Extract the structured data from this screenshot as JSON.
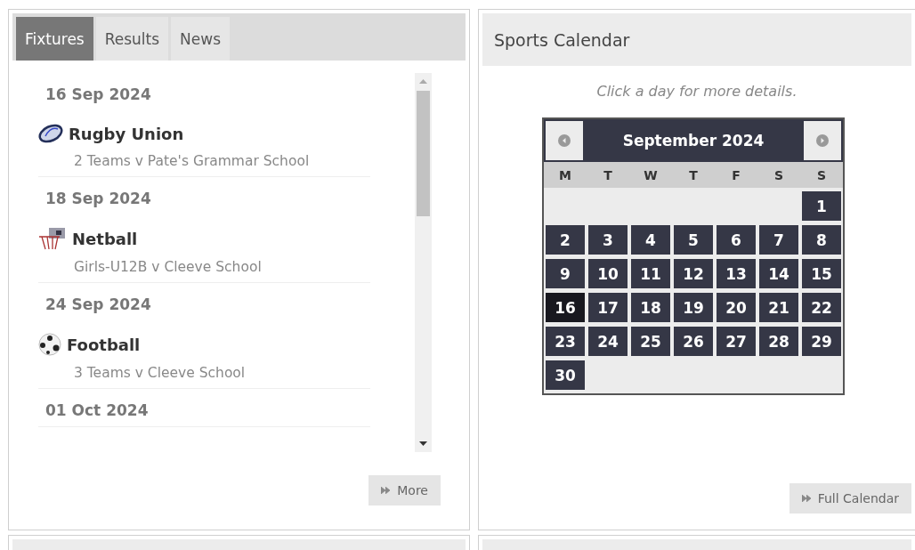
{
  "fixtures_panel": {
    "tabs": [
      {
        "label": "Fixtures",
        "selected": true
      },
      {
        "label": "Results",
        "selected": false
      },
      {
        "label": "News",
        "selected": false
      }
    ],
    "fixtures": [
      {
        "date": "16 Sep 2024",
        "kind": "rugby",
        "sport": "Rugby Union",
        "detail": "2 Teams v Pate's Grammar School"
      },
      {
        "date": "18 Sep 2024",
        "kind": "netball",
        "sport": "Netball",
        "detail": "Girls-U12B v Cleeve School"
      },
      {
        "date": "24 Sep 2024",
        "kind": "football",
        "sport": "Football",
        "detail": "3 Teams v Cleeve School"
      },
      {
        "date": "01 Oct 2024"
      }
    ],
    "more_button": "More"
  },
  "calendar_panel": {
    "title": "Sports Calendar",
    "hint": "Click a day for more details.",
    "month": "September 2024",
    "weekdays": [
      "M",
      "T",
      "W",
      "T",
      "F",
      "S",
      "S"
    ],
    "days": [
      {
        "day": "1",
        "selected": false,
        "kind": "sunday"
      },
      {
        "day": "2",
        "selected": false
      },
      {
        "day": "3",
        "selected": false
      },
      {
        "day": "4",
        "selected": false
      },
      {
        "day": "5",
        "selected": false
      },
      {
        "day": "6",
        "selected": false
      },
      {
        "day": "7",
        "selected": false
      },
      {
        "day": "8",
        "selected": false
      },
      {
        "day": "9",
        "selected": false
      },
      {
        "day": "10",
        "selected": false
      },
      {
        "day": "11",
        "selected": false
      },
      {
        "day": "12",
        "selected": false
      },
      {
        "day": "13",
        "selected": false
      },
      {
        "day": "14",
        "selected": false
      },
      {
        "day": "15",
        "selected": false
      },
      {
        "day": "16",
        "selected": true
      },
      {
        "day": "17",
        "selected": false
      },
      {
        "day": "18",
        "selected": false
      },
      {
        "day": "19",
        "selected": false
      },
      {
        "day": "20",
        "selected": false
      },
      {
        "day": "21",
        "selected": false
      },
      {
        "day": "22",
        "selected": false
      },
      {
        "day": "23",
        "selected": false
      },
      {
        "day": "24",
        "selected": false
      },
      {
        "day": "25",
        "selected": false
      },
      {
        "day": "26",
        "selected": false
      },
      {
        "day": "27",
        "selected": false
      },
      {
        "day": "28",
        "selected": false
      },
      {
        "day": "29",
        "selected": false
      },
      {
        "day": "30",
        "selected": false
      }
    ],
    "full_calendar_button": "Full Calendar"
  }
}
